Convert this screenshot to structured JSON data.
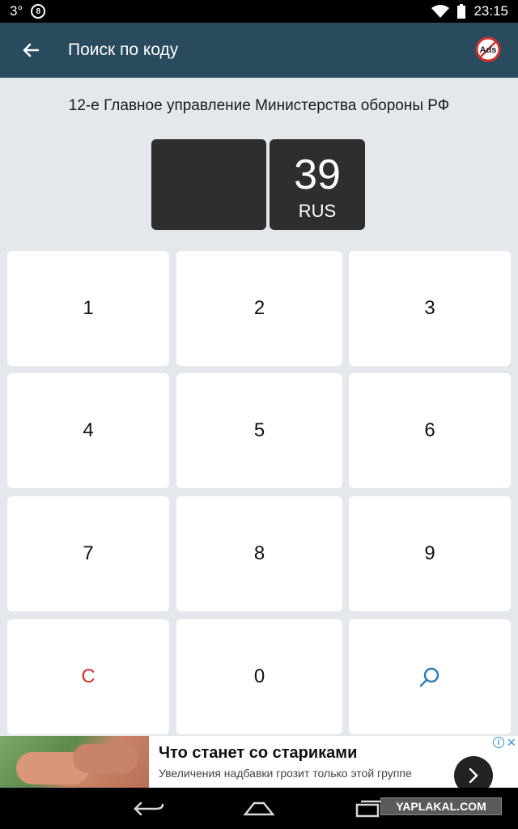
{
  "status_bar": {
    "temperature": "3°",
    "time": "23:15",
    "icons": [
      "notification-icon",
      "wifi-icon",
      "battery-icon"
    ]
  },
  "app_bar": {
    "title": "Поиск по коду",
    "back_icon": "arrow-left-icon",
    "ads_label": "Ads"
  },
  "organization": "12-е Главное управление Министерства обороны РФ",
  "plate": {
    "code": "",
    "region": "39",
    "country": "RUS"
  },
  "keypad": {
    "k1": "1",
    "k2": "2",
    "k3": "3",
    "k4": "4",
    "k5": "5",
    "k6": "6",
    "k7": "7",
    "k8": "8",
    "k9": "9",
    "clear": "C",
    "k0": "0",
    "search_icon": "search-icon"
  },
  "ad": {
    "title": "Что станет со стариками",
    "description": "Увеличения надбавки грозит только этой группе",
    "info": "i",
    "close": "✕"
  },
  "watermark": "YAPLAKAL.COM",
  "colors": {
    "app_bar": "#2a4a5e",
    "background": "#e4e8ed",
    "plate": "#2e2e2e",
    "clear": "#d32f2f",
    "search": "#2c7fb8"
  }
}
